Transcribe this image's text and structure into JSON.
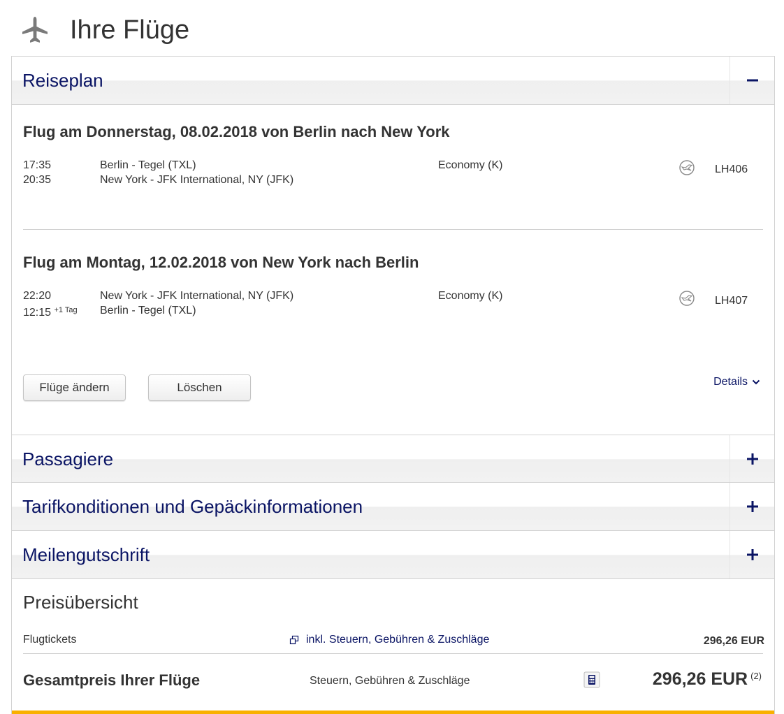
{
  "page": {
    "title": "Ihre Flüge",
    "header_icon": "airplane-icon"
  },
  "colors": {
    "heading_blue": "#0a1464",
    "accent_yellow": "#f9b000",
    "border": "#d2d2d2"
  },
  "reiseplan": {
    "title": "Reiseplan",
    "toggle": "−",
    "flights": [
      {
        "title": "Flug am Donnerstag, 08.02.2018 von Berlin nach New York",
        "departure_time": "17:35",
        "arrival_time": "20:35",
        "arrival_day_offset": "",
        "origin": "Berlin - Tegel (TXL)",
        "destination": "New York - JFK International, NY (JFK)",
        "cabin": "Economy (K)",
        "airline_icon": "lufthansa-crane-icon",
        "flight_number": "LH406"
      },
      {
        "title": "Flug am Montag, 12.02.2018 von New York nach Berlin",
        "departure_time": "22:20",
        "arrival_time": "12:15",
        "arrival_day_offset": "+1 Tag",
        "origin": "New York - JFK International, NY (JFK)",
        "destination": "Berlin - Tegel (TXL)",
        "cabin": "Economy (K)",
        "airline_icon": "lufthansa-crane-icon",
        "flight_number": "LH407"
      }
    ],
    "buttons": {
      "change": "Flüge ändern",
      "delete": "Löschen"
    },
    "details_link": "Details"
  },
  "sections": {
    "passagiere": {
      "title": "Passagiere",
      "toggle": "+"
    },
    "tarif": {
      "title": "Tarifkonditionen und Gepäckinformationen",
      "toggle": "+"
    },
    "meilen": {
      "title": "Meilengutschrift",
      "toggle": "+"
    }
  },
  "preis": {
    "title": "Preisübersicht",
    "tickets_label": "Flugtickets",
    "tickets_note": "inkl. Steuern, Gebühren & Zuschläge",
    "tickets_price": "296,26 EUR",
    "total_label": "Gesamtpreis Ihrer Flüge",
    "total_note": "Steuern, Gebühren & Zuschläge",
    "total_price": "296,26 EUR",
    "footnote": "(2)"
  }
}
